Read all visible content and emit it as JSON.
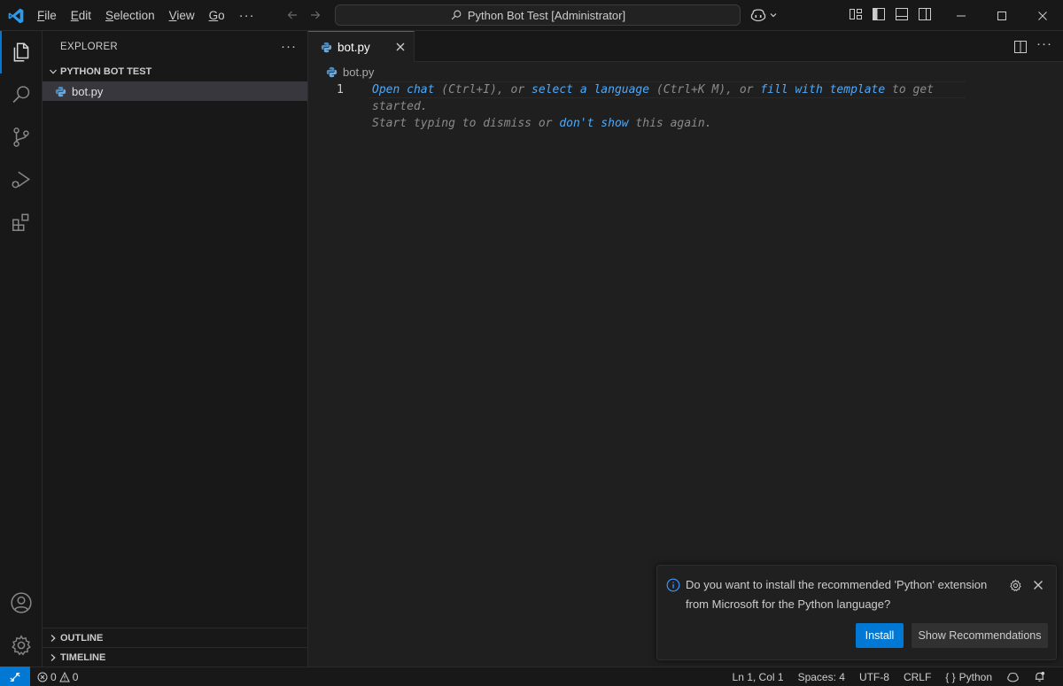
{
  "colors": {
    "accent": "#0078d4",
    "link": "#4daafc",
    "background": "#1f1f1f",
    "sidebar": "#181818"
  },
  "titlebar": {
    "menu": [
      "File",
      "Edit",
      "Selection",
      "View",
      "Go"
    ],
    "more": "···",
    "command_center": "Python Bot Test [Administrator]",
    "icons": [
      "vscode-logo-icon",
      "back-arrow-icon",
      "forward-arrow-icon",
      "search-icon",
      "copilot-icon",
      "customize-layout-icon",
      "toggle-primary-sidebar-icon",
      "toggle-panel-icon",
      "toggle-secondary-sidebar-icon",
      "minimize-icon",
      "maximize-icon",
      "close-icon"
    ]
  },
  "activitybar": {
    "items": [
      "explorer-icon",
      "search-icon",
      "source-control-icon",
      "run-debug-icon",
      "extensions-icon"
    ],
    "bottom": [
      "accounts-icon",
      "manage-gear-icon"
    ]
  },
  "sidebar": {
    "title": "EXPLORER",
    "more": "···",
    "folder": "PYTHON BOT TEST",
    "files": [
      "bot.py"
    ],
    "outline": "OUTLINE",
    "timeline": "TIMELINE"
  },
  "editor": {
    "tab": "bot.py",
    "breadcrumb": "bot.py",
    "line_number": "1",
    "hint": {
      "open_chat": "Open chat",
      "t1": " (Ctrl+I), or ",
      "select_language": "select a language",
      "t2": " (Ctrl+K M), or ",
      "fill_template": "fill with template",
      "t3": " to get started.",
      "t4": "Start typing to dismiss or ",
      "dont_show": "don't show",
      "t5": " this again."
    }
  },
  "notification": {
    "message": "Do you want to install the recommended 'Python' extension from Microsoft for the Python language?",
    "install": "Install",
    "show_recommendations": "Show Recommendations"
  },
  "statusbar": {
    "errors": "0",
    "warnings": "0",
    "position": "Ln 1, Col 1",
    "spaces": "Spaces: 4",
    "encoding": "UTF-8",
    "eol": "CRLF",
    "language_braces": "{ }",
    "language": "Python"
  }
}
